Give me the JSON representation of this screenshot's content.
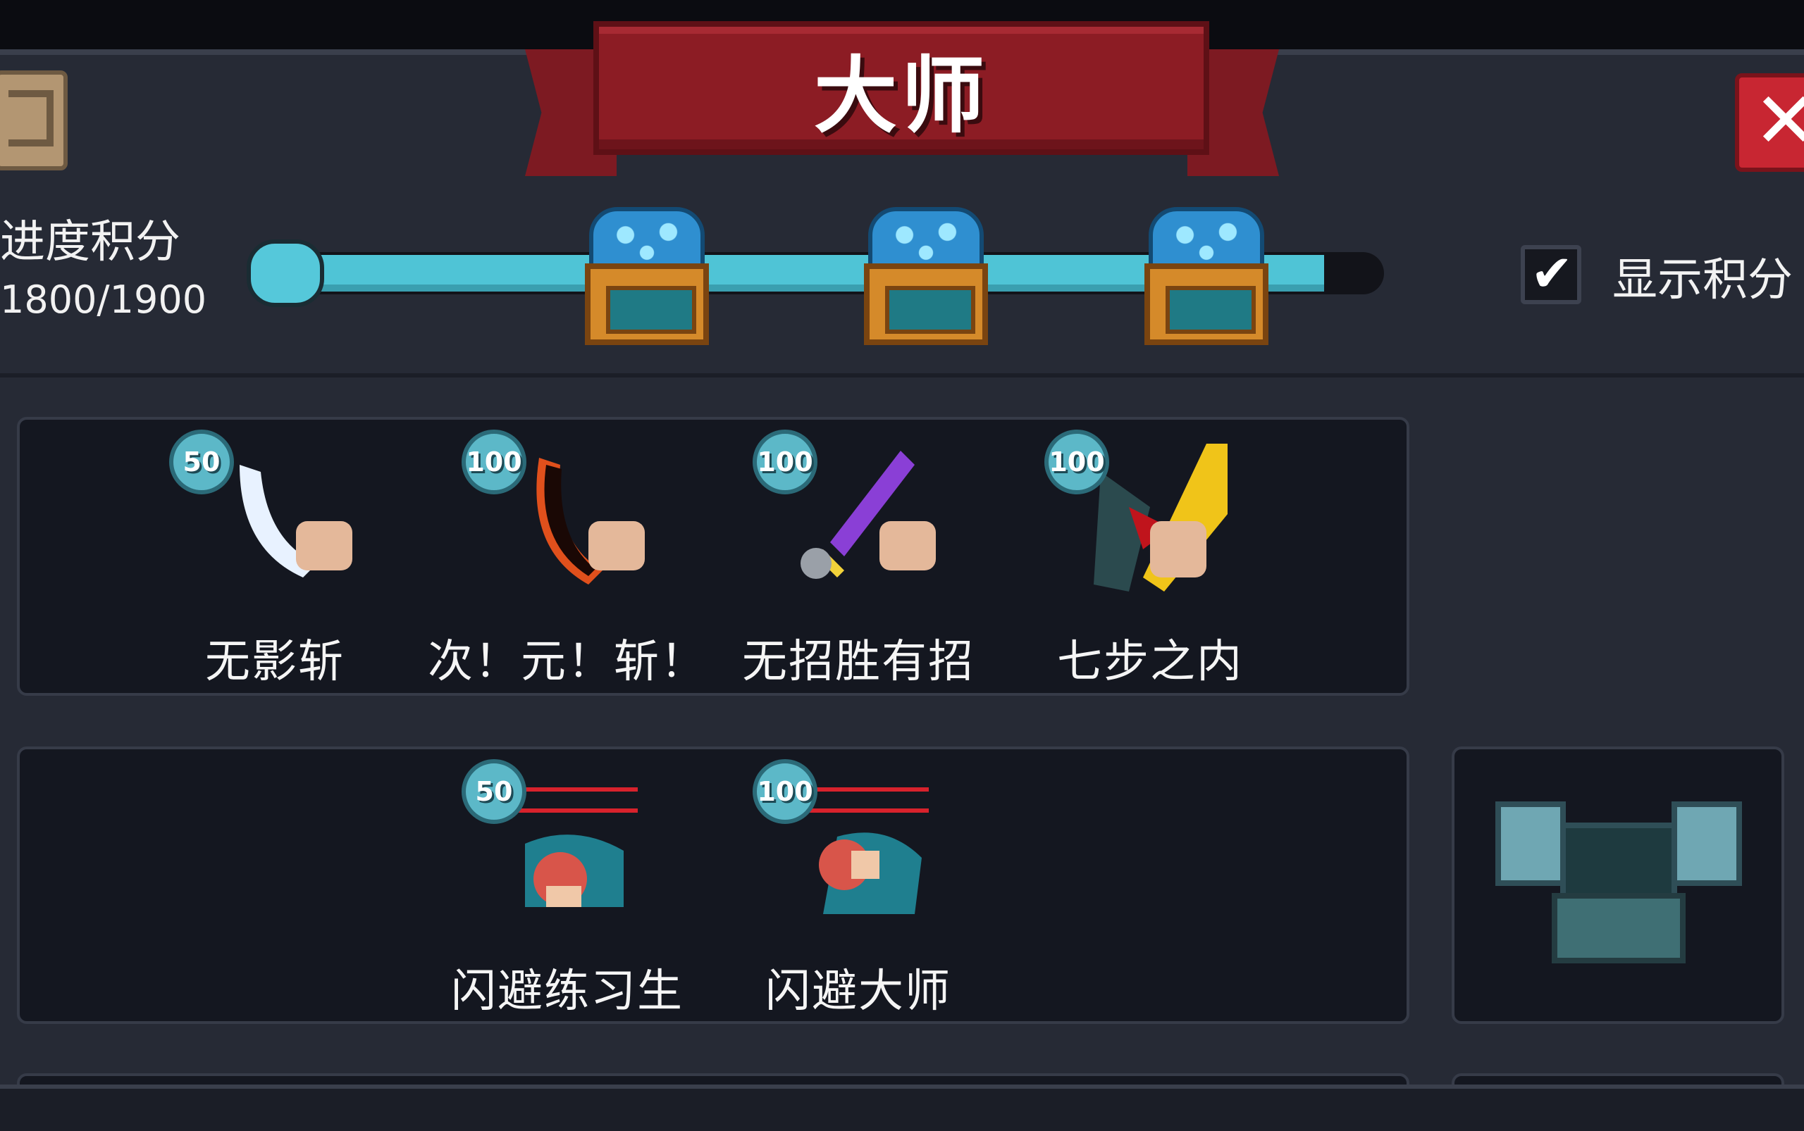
{
  "title": "大师",
  "progress": {
    "label": "进度积分",
    "value_text": "1800/1900",
    "current": 1800,
    "max": 1900,
    "fill_fraction": 0.947,
    "chest_count": 3
  },
  "show_points": {
    "label": "显示积分",
    "checked": true
  },
  "colors": {
    "banner": "#8c1c24",
    "progress_fill": "#4fc4d6",
    "close": "#c82632",
    "badge": "#5cb8c8"
  },
  "icons": {
    "book": "book-icon",
    "close": "close-icon",
    "chest": "gem-chest-icon",
    "check": "checkmark-icon",
    "reward": "empty-chest-icon"
  },
  "row1": [
    {
      "points": "50",
      "name": "无影斩",
      "icon": "hand-slash-icon"
    },
    {
      "points": "100",
      "name": "次！元！斩！",
      "icon": "dimension-slash-icon"
    },
    {
      "points": "100",
      "name": "无招胜有招",
      "icon": "purple-sword-icon"
    },
    {
      "points": "100",
      "name": "七步之内",
      "icon": "golden-sword-icon"
    }
  ],
  "row2": [
    {
      "points": "50",
      "name": "闪避练习生",
      "icon": "dodge-apprentice-icon"
    },
    {
      "points": "100",
      "name": "闪避大师",
      "icon": "dodge-master-icon"
    }
  ]
}
